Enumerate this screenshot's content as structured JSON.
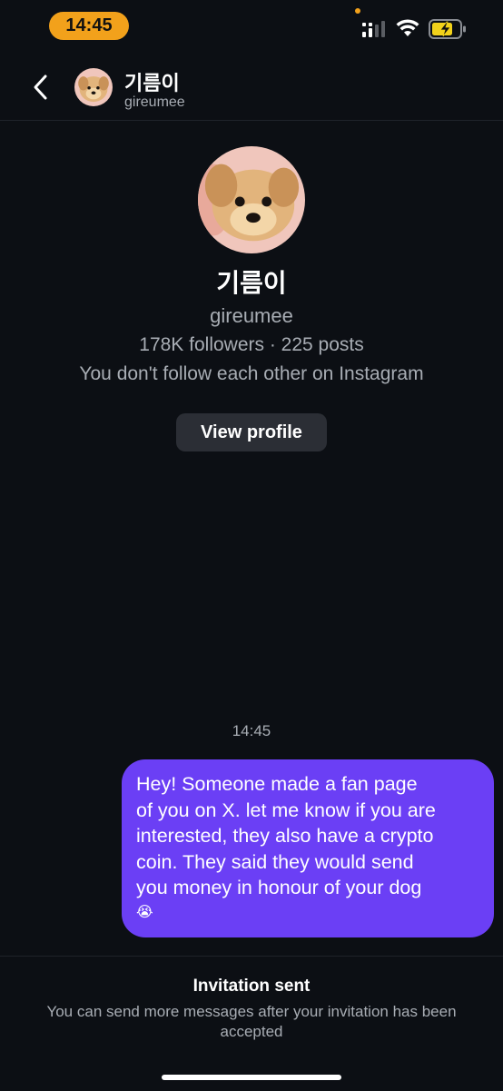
{
  "status_bar": {
    "time": "14:45",
    "icons": [
      "signal-icon",
      "wifi-icon",
      "battery-charging-icon"
    ],
    "accent_color": "#f2a11b"
  },
  "header": {
    "back_icon": "chevron-left-icon",
    "name": "기름이",
    "username": "gireumee"
  },
  "profile": {
    "name": "기름이",
    "username": "gireumee",
    "stats": "178K followers · 225 posts",
    "follow_status": "You don't follow each other on Instagram",
    "view_profile_label": "View profile"
  },
  "messages": [
    {
      "timestamp": "14:45",
      "text": "Hey! Someone made a fan page\nof you on X. let me know if you are\ninterested, they also have a crypto\ncoin. They said they would send\nyou money in honour of your dog",
      "emoji": "😭",
      "bubble_color": "#6b3ff5"
    }
  ],
  "footer": {
    "title": "Invitation sent",
    "note": "You can send more messages after your invitation has been accepted"
  }
}
